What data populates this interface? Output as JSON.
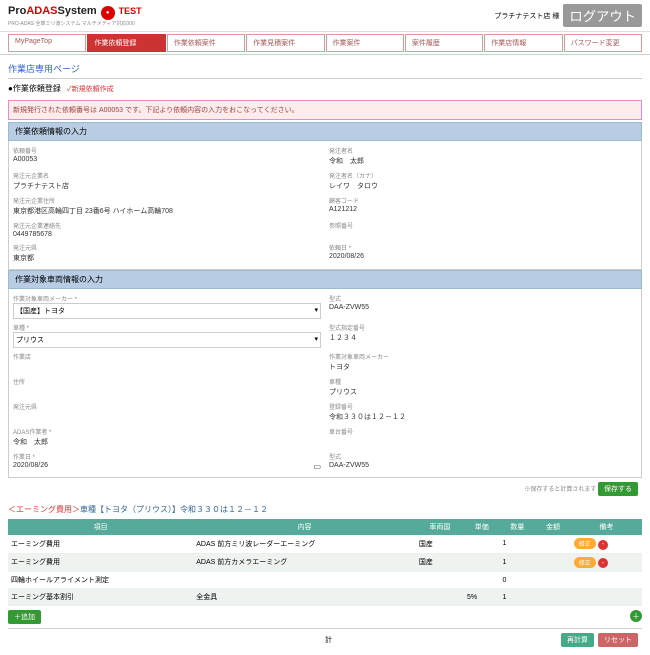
{
  "header": {
    "logo_pro": "Pro",
    "logo_adas": "ADAS",
    "logo_sys": "System",
    "sublogo": "PRO-ADAS 全車ミリ波システム   マルチメディア対応000",
    "test": "TEST",
    "user": "プラチナテスト店 様",
    "logout": "ログアウト"
  },
  "tabs": [
    "MyPageTop",
    "作業依頼登録",
    "作業依頼案件",
    "作業見積案件",
    "作業案件",
    "案件履歴",
    "作業店情報",
    "パスワード変更"
  ],
  "page_title": "作業店専用ページ",
  "subtitle": "●作業依頼登録",
  "newreq": "✓新規依頼作成",
  "alert": "新規発行された依頼番号は A00053 です。下記より依頼内容の入力をおこなってください。",
  "sec1": {
    "title": "作業依頼情報の入力",
    "left": [
      {
        "l": "依頼番号",
        "v": "A00053"
      },
      {
        "l": "発注元企業名",
        "v": "プラチナテスト店"
      },
      {
        "l": "発注元企業住所",
        "v": "東京都港区高輪四丁目 23番6号 ハイホーム高輪708"
      },
      {
        "l": "発注元企業連絡先",
        "v": "0449785678"
      },
      {
        "l": "発注元県",
        "v": "東京都"
      }
    ],
    "right": [
      {
        "l": "発注者名",
        "v": "令和　太郎"
      },
      {
        "l": "発注者名（カナ）",
        "v": "レイワ　タロウ"
      },
      {
        "l": "顧客コード",
        "v": "A121212"
      },
      {
        "l": "参照番号",
        "v": ""
      },
      {
        "l": "依頼日 *",
        "v": "2020/08/26"
      }
    ]
  },
  "sec2": {
    "title": "作業対象車両情報の入力",
    "left": [
      {
        "l": "作業対象車両メーカー *",
        "v": "【国産】トヨタ",
        "sel": true
      },
      {
        "l": "車種 *",
        "v": "プリウス",
        "sel": true
      },
      {
        "l": "作業店",
        "v": ""
      },
      {
        "l": "住所",
        "v": ""
      },
      {
        "l": "発注元県",
        "v": ""
      },
      {
        "l": "ADAS作業者 *",
        "v": "令和　太郎"
      },
      {
        "l": "作業日 *",
        "v": "2020/08/26",
        "date": true
      }
    ],
    "right": [
      {
        "l": "型式",
        "v": "DAA-ZVW55"
      },
      {
        "l": "型式指定番号",
        "v": "１２３４"
      },
      {
        "l": "作業対象車両メーカー",
        "v": "トヨタ"
      },
      {
        "l": "車種",
        "v": "プリウス"
      },
      {
        "l": "登録番号",
        "v": "令和３３０は１２－１２"
      },
      {
        "l": "車台番号",
        "v": ""
      },
      {
        "l": "型式",
        "v": "DAA-ZVW55"
      }
    ]
  },
  "save_note": "※保存すると計算されます",
  "save_btn": "保存する",
  "aim": {
    "prefix": "＜エーミング費用＞",
    "veh": "車種【トヨタ（プリウス）】令和３３０は１２－１２"
  },
  "cols": [
    "項目",
    "内容",
    "車両国",
    "単価",
    "数量",
    "金額",
    "備考"
  ],
  "rows": [
    {
      "c": [
        "エーミング費用",
        "ADAS 前方ミリ波レーダーエーミング",
        "国産",
        "",
        "1",
        "",
        ""
      ],
      "mod": true
    },
    {
      "c": [
        "エーミング費用",
        "ADAS 前方カメラエーミング",
        "国産",
        "",
        "1",
        "",
        ""
      ],
      "mod": true
    },
    {
      "c": [
        "四輪ホイールアライメント測定",
        "",
        "",
        "",
        "0",
        "",
        ""
      ]
    },
    {
      "c": [
        "エーミング基本割引",
        "全金具",
        "",
        "5%",
        "1",
        "",
        ""
      ]
    }
  ],
  "add_btn": "＋追加",
  "total_label": "計",
  "calc_btn": "再計算",
  "reset_btn": "リセット",
  "mod_btn": "修正"
}
